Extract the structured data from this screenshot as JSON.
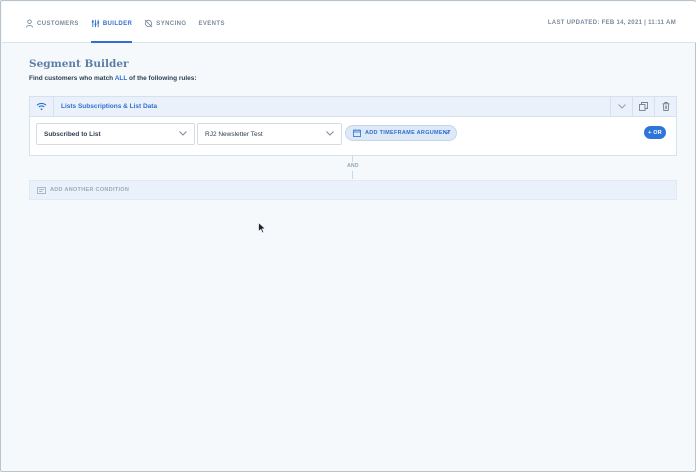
{
  "nav": {
    "items": [
      {
        "label": "CUSTOMERS",
        "icon": "person-icon"
      },
      {
        "label": "BUILDER",
        "icon": "builder-icon",
        "active": true
      },
      {
        "label": "SYNCING",
        "icon": "sync-off-icon"
      },
      {
        "label": "EVENTS"
      }
    ],
    "last_updated": "LAST UPDATED: FEB 14, 2021 | 11:11 AM"
  },
  "page": {
    "title": "Segment Builder",
    "subtitle_pre": "Find customers who match ",
    "subtitle_all": "ALL",
    "subtitle_post": " of the following rules:"
  },
  "rule": {
    "title": "Lists Subscriptions & List Data",
    "condition_select": "Subscribed to List",
    "list_select": "RJ2 Newsletter Test",
    "timeframe_label": "ADD TIMEFRAME ARGUMENT",
    "or_label": "+ OR"
  },
  "and_label": "AND",
  "add_condition_label": "ADD ANOTHER CONDITION",
  "colors": {
    "accent": "#2f6fd0",
    "header_bg": "#eaf1fa",
    "page_bg": "#f6f9fc"
  }
}
